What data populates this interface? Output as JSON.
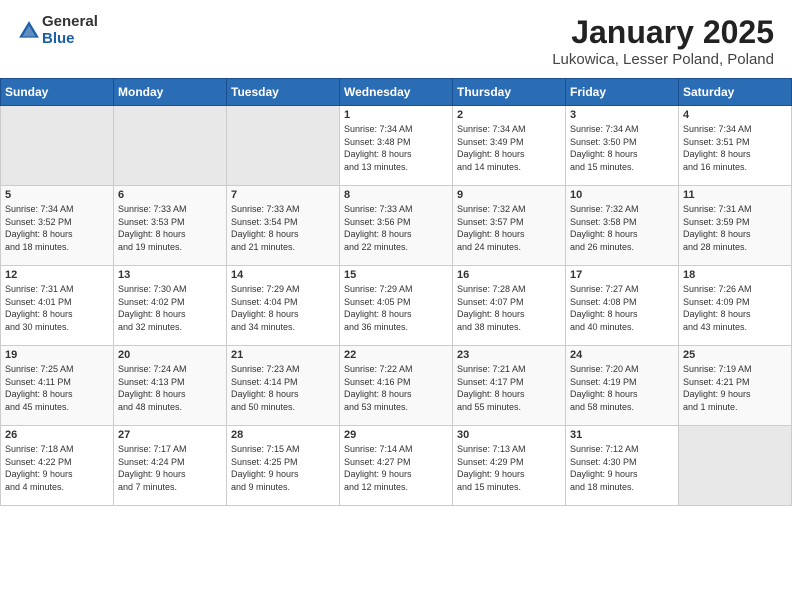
{
  "logo": {
    "general": "General",
    "blue": "Blue"
  },
  "header": {
    "month": "January 2025",
    "location": "Lukowica, Lesser Poland, Poland"
  },
  "weekdays": [
    "Sunday",
    "Monday",
    "Tuesday",
    "Wednesday",
    "Thursday",
    "Friday",
    "Saturday"
  ],
  "weeks": [
    [
      {
        "day": "",
        "info": ""
      },
      {
        "day": "",
        "info": ""
      },
      {
        "day": "",
        "info": ""
      },
      {
        "day": "1",
        "info": "Sunrise: 7:34 AM\nSunset: 3:48 PM\nDaylight: 8 hours\nand 13 minutes."
      },
      {
        "day": "2",
        "info": "Sunrise: 7:34 AM\nSunset: 3:49 PM\nDaylight: 8 hours\nand 14 minutes."
      },
      {
        "day": "3",
        "info": "Sunrise: 7:34 AM\nSunset: 3:50 PM\nDaylight: 8 hours\nand 15 minutes."
      },
      {
        "day": "4",
        "info": "Sunrise: 7:34 AM\nSunset: 3:51 PM\nDaylight: 8 hours\nand 16 minutes."
      }
    ],
    [
      {
        "day": "5",
        "info": "Sunrise: 7:34 AM\nSunset: 3:52 PM\nDaylight: 8 hours\nand 18 minutes."
      },
      {
        "day": "6",
        "info": "Sunrise: 7:33 AM\nSunset: 3:53 PM\nDaylight: 8 hours\nand 19 minutes."
      },
      {
        "day": "7",
        "info": "Sunrise: 7:33 AM\nSunset: 3:54 PM\nDaylight: 8 hours\nand 21 minutes."
      },
      {
        "day": "8",
        "info": "Sunrise: 7:33 AM\nSunset: 3:56 PM\nDaylight: 8 hours\nand 22 minutes."
      },
      {
        "day": "9",
        "info": "Sunrise: 7:32 AM\nSunset: 3:57 PM\nDaylight: 8 hours\nand 24 minutes."
      },
      {
        "day": "10",
        "info": "Sunrise: 7:32 AM\nSunset: 3:58 PM\nDaylight: 8 hours\nand 26 minutes."
      },
      {
        "day": "11",
        "info": "Sunrise: 7:31 AM\nSunset: 3:59 PM\nDaylight: 8 hours\nand 28 minutes."
      }
    ],
    [
      {
        "day": "12",
        "info": "Sunrise: 7:31 AM\nSunset: 4:01 PM\nDaylight: 8 hours\nand 30 minutes."
      },
      {
        "day": "13",
        "info": "Sunrise: 7:30 AM\nSunset: 4:02 PM\nDaylight: 8 hours\nand 32 minutes."
      },
      {
        "day": "14",
        "info": "Sunrise: 7:29 AM\nSunset: 4:04 PM\nDaylight: 8 hours\nand 34 minutes."
      },
      {
        "day": "15",
        "info": "Sunrise: 7:29 AM\nSunset: 4:05 PM\nDaylight: 8 hours\nand 36 minutes."
      },
      {
        "day": "16",
        "info": "Sunrise: 7:28 AM\nSunset: 4:07 PM\nDaylight: 8 hours\nand 38 minutes."
      },
      {
        "day": "17",
        "info": "Sunrise: 7:27 AM\nSunset: 4:08 PM\nDaylight: 8 hours\nand 40 minutes."
      },
      {
        "day": "18",
        "info": "Sunrise: 7:26 AM\nSunset: 4:09 PM\nDaylight: 8 hours\nand 43 minutes."
      }
    ],
    [
      {
        "day": "19",
        "info": "Sunrise: 7:25 AM\nSunset: 4:11 PM\nDaylight: 8 hours\nand 45 minutes."
      },
      {
        "day": "20",
        "info": "Sunrise: 7:24 AM\nSunset: 4:13 PM\nDaylight: 8 hours\nand 48 minutes."
      },
      {
        "day": "21",
        "info": "Sunrise: 7:23 AM\nSunset: 4:14 PM\nDaylight: 8 hours\nand 50 minutes."
      },
      {
        "day": "22",
        "info": "Sunrise: 7:22 AM\nSunset: 4:16 PM\nDaylight: 8 hours\nand 53 minutes."
      },
      {
        "day": "23",
        "info": "Sunrise: 7:21 AM\nSunset: 4:17 PM\nDaylight: 8 hours\nand 55 minutes."
      },
      {
        "day": "24",
        "info": "Sunrise: 7:20 AM\nSunset: 4:19 PM\nDaylight: 8 hours\nand 58 minutes."
      },
      {
        "day": "25",
        "info": "Sunrise: 7:19 AM\nSunset: 4:21 PM\nDaylight: 9 hours\nand 1 minute."
      }
    ],
    [
      {
        "day": "26",
        "info": "Sunrise: 7:18 AM\nSunset: 4:22 PM\nDaylight: 9 hours\nand 4 minutes."
      },
      {
        "day": "27",
        "info": "Sunrise: 7:17 AM\nSunset: 4:24 PM\nDaylight: 9 hours\nand 7 minutes."
      },
      {
        "day": "28",
        "info": "Sunrise: 7:15 AM\nSunset: 4:25 PM\nDaylight: 9 hours\nand 9 minutes."
      },
      {
        "day": "29",
        "info": "Sunrise: 7:14 AM\nSunset: 4:27 PM\nDaylight: 9 hours\nand 12 minutes."
      },
      {
        "day": "30",
        "info": "Sunrise: 7:13 AM\nSunset: 4:29 PM\nDaylight: 9 hours\nand 15 minutes."
      },
      {
        "day": "31",
        "info": "Sunrise: 7:12 AM\nSunset: 4:30 PM\nDaylight: 9 hours\nand 18 minutes."
      },
      {
        "day": "",
        "info": ""
      }
    ]
  ]
}
